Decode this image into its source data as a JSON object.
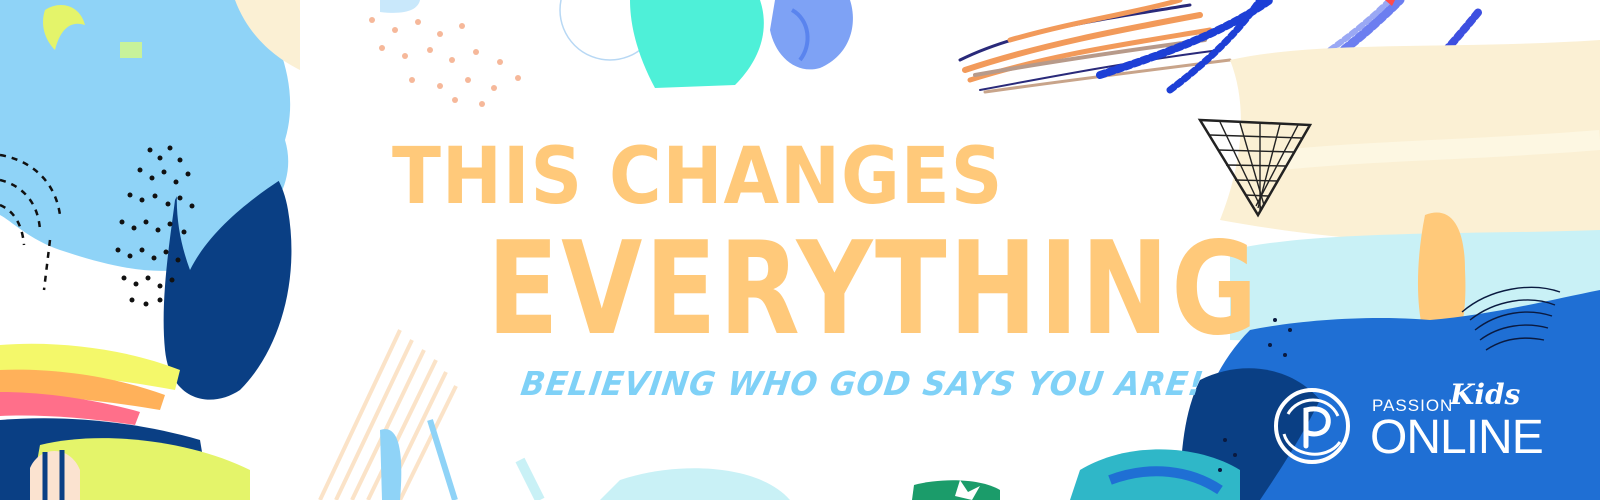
{
  "headline": {
    "line1": "THIS CHANGES",
    "line2": "EVERYTHING",
    "tagline": "BELIEVING WHO GOD SAYS YOU ARE!"
  },
  "logo": {
    "brand": "PASSION",
    "kids": "Kids",
    "online": "ONLINE",
    "mark_icon": "passion-p-swirl-icon"
  },
  "colors": {
    "headline": "#ffc97a",
    "tagline": "#7fd1f7",
    "light_blue": "#8fd3f7",
    "navy": "#0a3f84",
    "royal_blue": "#1f6fd4",
    "aqua": "#4ef0d8",
    "yellow_green": "#e4f46a",
    "peach": "#fbe3b8"
  }
}
